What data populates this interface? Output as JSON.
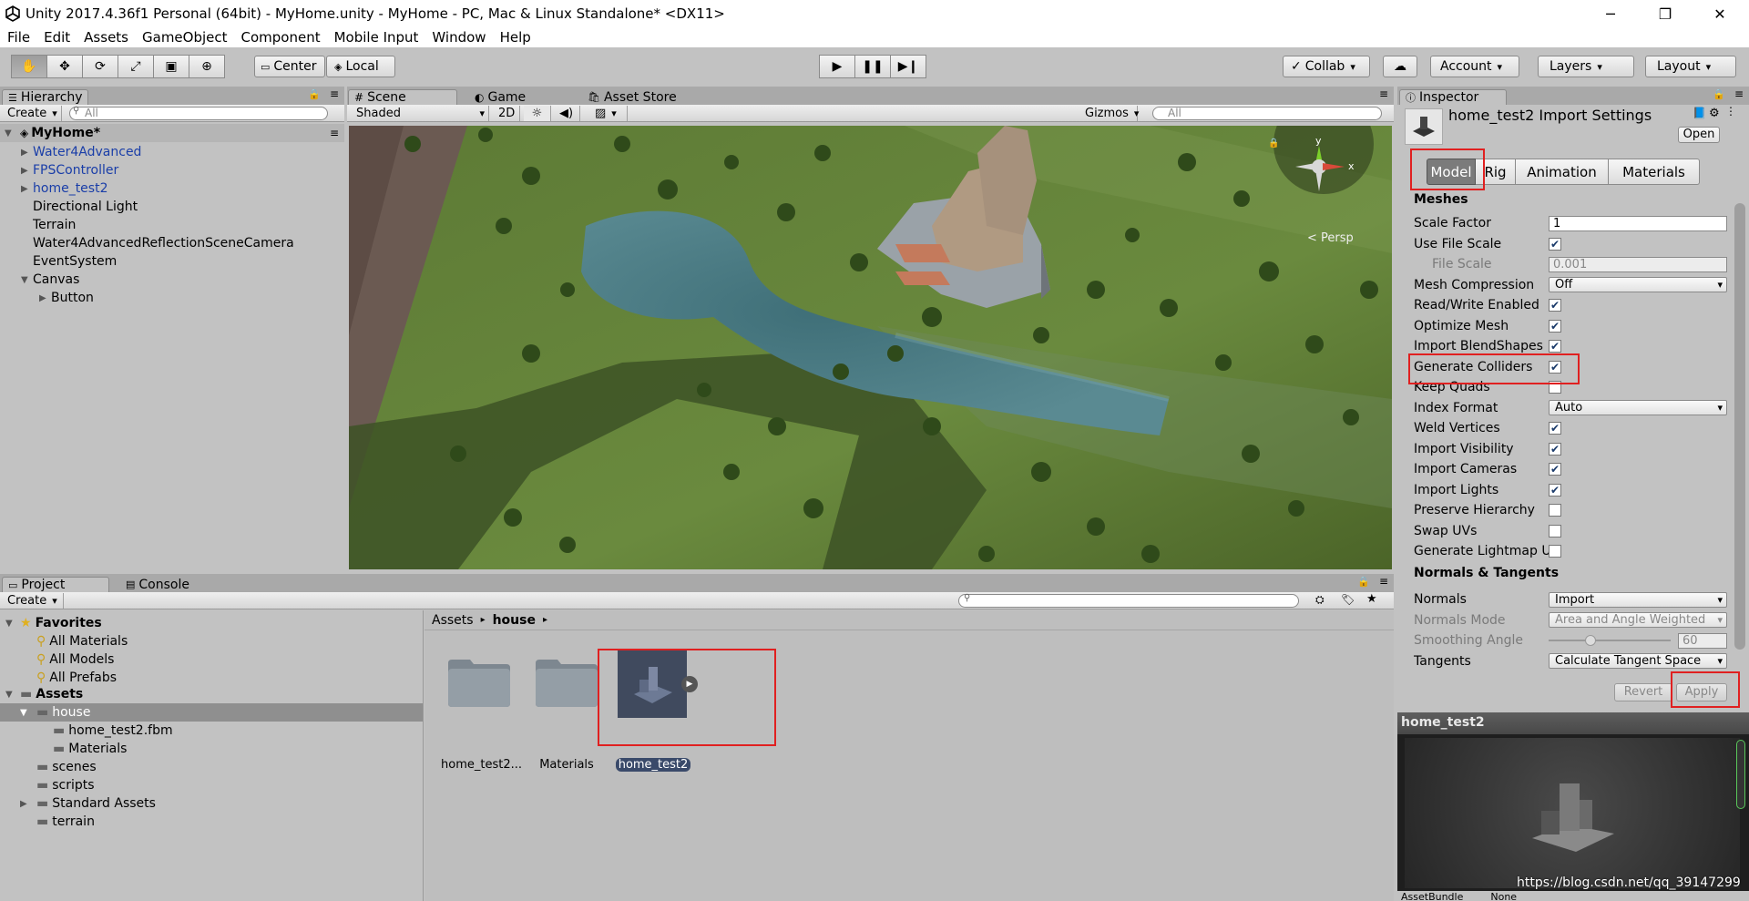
{
  "window": {
    "title": "Unity 2017.4.36f1 Personal (64bit) - MyHome.unity - MyHome - PC, Mac & Linux Standalone* <DX11>",
    "minimize": "─",
    "restore": "❐",
    "close": "✕"
  },
  "menu": [
    "File",
    "Edit",
    "Assets",
    "GameObject",
    "Component",
    "Mobile Input",
    "Window",
    "Help"
  ],
  "toolbar": {
    "pivot": "Center",
    "space": "Local",
    "collab": "Collab",
    "account": "Account",
    "layers": "Layers",
    "layout": "Layout"
  },
  "hierarchy": {
    "tab": "Hierarchy",
    "create": "Create",
    "search_placeholder": "All",
    "scene": "MyHome*",
    "items": [
      {
        "label": "Water4Advanced",
        "blue": true,
        "arrow": true,
        "indent": 1
      },
      {
        "label": "FPSController",
        "blue": true,
        "arrow": true,
        "indent": 1
      },
      {
        "label": "home_test2",
        "blue": true,
        "arrow": true,
        "indent": 1
      },
      {
        "label": "Directional Light",
        "indent": 1
      },
      {
        "label": "Terrain",
        "indent": 1
      },
      {
        "label": "Water4AdvancedReflectionSceneCamera",
        "indent": 1
      },
      {
        "label": "EventSystem",
        "indent": 1
      },
      {
        "label": "Canvas",
        "arrow": true,
        "expanded": true,
        "indent": 1
      },
      {
        "label": "Button",
        "arrow": true,
        "indent": 2
      }
    ]
  },
  "scene": {
    "tabs": [
      "Scene",
      "Game",
      "Asset Store"
    ],
    "shading": "Shaded",
    "mode2d": "2D",
    "gizmos": "Gizmos",
    "search_placeholder": "All",
    "persp": "< Persp",
    "axis_y": "y",
    "axis_x": "x"
  },
  "project": {
    "tabs": [
      "Project",
      "Console"
    ],
    "create": "Create",
    "favorites": "Favorites",
    "favorite_items": [
      "All Materials",
      "All Models",
      "All Prefabs"
    ],
    "assets_root": "Assets",
    "tree": [
      {
        "label": "house",
        "indent": 1,
        "selected": true,
        "expanded": true
      },
      {
        "label": "home_test2.fbm",
        "indent": 2
      },
      {
        "label": "Materials",
        "indent": 2
      },
      {
        "label": "scenes",
        "indent": 1
      },
      {
        "label": "scripts",
        "indent": 1
      },
      {
        "label": "Standard Assets",
        "indent": 1,
        "arrow": true
      },
      {
        "label": "terrain",
        "indent": 1
      }
    ],
    "breadcrumb": [
      "Assets",
      "house"
    ],
    "assets": [
      "home_test2...",
      "Materials",
      "home_test2"
    ]
  },
  "inspector": {
    "tab": "Inspector",
    "title": "home_test2 Import Settings",
    "open": "Open",
    "tabs": [
      "Model",
      "Rig",
      "Animation",
      "Materials"
    ],
    "meshes_header": "Meshes",
    "rows": [
      {
        "label": "Scale Factor",
        "type": "field",
        "value": "1"
      },
      {
        "label": "Use File Scale",
        "type": "check",
        "checked": true
      },
      {
        "label": "File Scale",
        "type": "field",
        "value": "0.001",
        "disabled": true,
        "indent": true
      },
      {
        "label": "Mesh Compression",
        "type": "select",
        "value": "Off"
      },
      {
        "label": "Read/Write Enabled",
        "type": "check",
        "checked": true
      },
      {
        "label": "Optimize Mesh",
        "type": "check",
        "checked": true
      },
      {
        "label": "Import BlendShapes",
        "type": "check",
        "checked": true
      },
      {
        "label": "Generate Colliders",
        "type": "check",
        "checked": true
      },
      {
        "label": "Keep Quads",
        "type": "check",
        "checked": false
      },
      {
        "label": "Index Format",
        "type": "select",
        "value": "Auto"
      },
      {
        "label": "Weld Vertices",
        "type": "check",
        "checked": true
      },
      {
        "label": "Import Visibility",
        "type": "check",
        "checked": true
      },
      {
        "label": "Import Cameras",
        "type": "check",
        "checked": true
      },
      {
        "label": "Import Lights",
        "type": "check",
        "checked": true
      },
      {
        "label": "Preserve Hierarchy",
        "type": "check",
        "checked": false
      },
      {
        "label": "Swap UVs",
        "type": "check",
        "checked": false
      },
      {
        "label": "Generate Lightmap U",
        "type": "check",
        "checked": false
      }
    ],
    "normals_header": "Normals & Tangents",
    "normal_rows": [
      {
        "label": "Normals",
        "type": "select",
        "value": "Import"
      },
      {
        "label": "Normals Mode",
        "type": "select",
        "value": "Area and Angle Weighted",
        "disabled": true
      },
      {
        "label": "Smoothing Angle",
        "type": "slider",
        "value": "60",
        "disabled": true
      },
      {
        "label": "Tangents",
        "type": "select",
        "value": "Calculate Tangent Space"
      }
    ],
    "revert": "Revert",
    "apply": "Apply",
    "preview_title": "home_test2",
    "assetbundle": "AssetBundle",
    "assetbundle_value": "None"
  },
  "watermark": "https://blog.csdn.net/qq_39147299"
}
